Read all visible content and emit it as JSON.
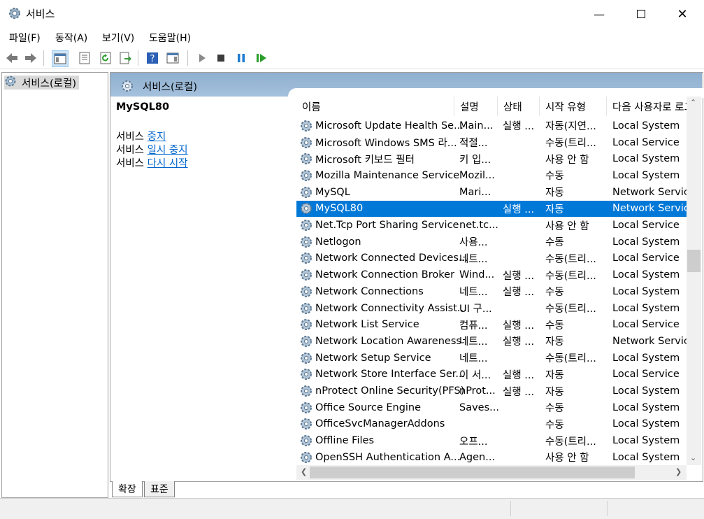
{
  "window": {
    "title": "서비스",
    "icon": "gear-icon"
  },
  "menu": [
    {
      "label": "파일(F)"
    },
    {
      "label": "동작(A)"
    },
    {
      "label": "보기(V)"
    },
    {
      "label": "도움말(H)"
    }
  ],
  "tree": {
    "item_label": "서비스(로컬)"
  },
  "header": {
    "title": "서비스(로컬)"
  },
  "extended": {
    "service_name": "MySQL80",
    "lines": [
      {
        "prefix": "서비스",
        "link": "중지"
      },
      {
        "prefix": "서비스",
        "link": "일시 중지"
      },
      {
        "prefix": "서비스",
        "link": "다시 시작"
      }
    ]
  },
  "table": {
    "columns": [
      "이름",
      "설명",
      "상태",
      "시작 유형",
      "다음 사용자로 로그온"
    ],
    "sort_indicator": "^",
    "selected_index": 5,
    "rows": [
      [
        "Microsoft Update Health Se...",
        "Main...",
        "실행 ...",
        "자동(지연...",
        "Local System"
      ],
      [
        "Microsoft Windows SMS 라...",
        "적절...",
        "",
        "수동(트리...",
        "Local Service"
      ],
      [
        "Microsoft 키보드 필터",
        "키 입...",
        "",
        "사용 안 함",
        "Local System"
      ],
      [
        "Mozilla Maintenance Service",
        "Mozil...",
        "",
        "수동",
        "Local System"
      ],
      [
        "MySQL",
        "Mari...",
        "",
        "자동",
        "Network Service"
      ],
      [
        "MySQL80",
        "",
        "실행 ...",
        "자동",
        "Network Service"
      ],
      [
        "Net.Tcp Port Sharing Service",
        "net.tc...",
        "",
        "사용 안 함",
        "Local Service"
      ],
      [
        "Netlogon",
        "사용...",
        "",
        "수동",
        "Local System"
      ],
      [
        "Network Connected Devices...",
        "네트...",
        "",
        "수동(트리...",
        "Local Service"
      ],
      [
        "Network Connection Broker",
        "Wind...",
        "실행 ...",
        "수동(트리...",
        "Local System"
      ],
      [
        "Network Connections",
        "네트...",
        "실행 ...",
        "수동",
        "Local System"
      ],
      [
        "Network Connectivity Assist...",
        "UI 구...",
        "",
        "수동(트리...",
        "Local System"
      ],
      [
        "Network List Service",
        "컴퓨...",
        "실행 ...",
        "수동",
        "Local Service"
      ],
      [
        "Network Location Awareness",
        "네트...",
        "실행 ...",
        "자동",
        "Network Service"
      ],
      [
        "Network Setup Service",
        "네트...",
        "",
        "수동(트리...",
        "Local System"
      ],
      [
        "Network Store Interface Ser...",
        "이 서...",
        "실행 ...",
        "자동",
        "Local Service"
      ],
      [
        "nProtect Online Security(PFS)",
        "nProt...",
        "실행 ...",
        "자동",
        "Local System"
      ],
      [
        "Office  Source Engine",
        "Saves...",
        "",
        "수동",
        "Local System"
      ],
      [
        "OfficeSvcManagerAddons",
        "",
        "",
        "수동",
        "Local System"
      ],
      [
        "Offline Files",
        "오프...",
        "",
        "수동(트리...",
        "Local System"
      ],
      [
        "OpenSSH Authentication A...",
        "Agen...",
        "",
        "사용 안 함",
        "Local System"
      ]
    ]
  },
  "tabs": [
    {
      "label": "확장"
    },
    {
      "label": "표준"
    }
  ],
  "colors": {
    "selection": "#0078d7",
    "header_band": "#9ab8d6",
    "link": "#0066cc"
  }
}
